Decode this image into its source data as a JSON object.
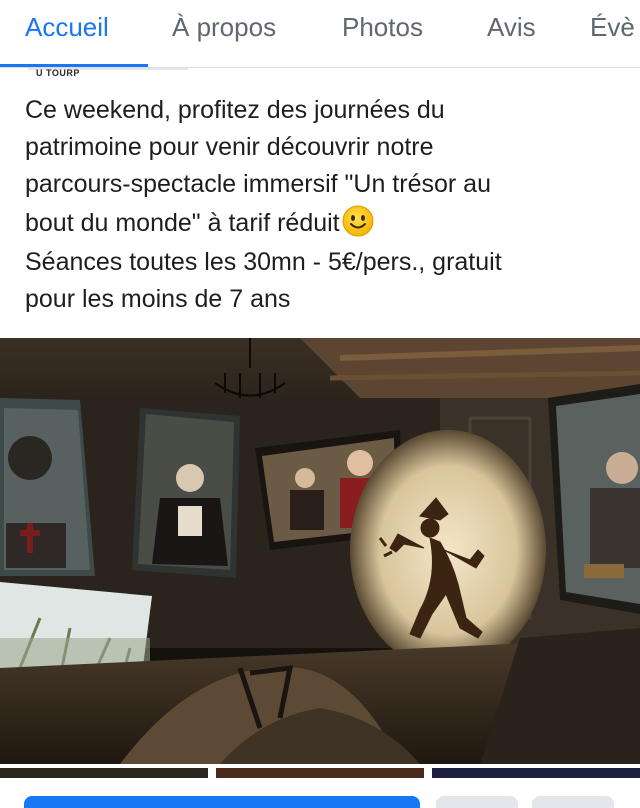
{
  "tabs": [
    {
      "label": "Accueil",
      "active": true
    },
    {
      "label": "À propos",
      "active": false
    },
    {
      "label": "Photos",
      "active": false
    },
    {
      "label": "Avis",
      "active": false
    },
    {
      "label": "Évè",
      "active": false
    }
  ],
  "post": {
    "brand_fragment": "U TOURP",
    "lines": [
      "Ce weekend, profitez des journées du",
      "patrimoine pour venir découvrir notre",
      "parcours-spectacle immersif \"Un trésor au",
      "bout du monde\" à tarif réduit",
      "Séances toutes les 30mn - 5€/pers., gratuit",
      "pour les moins de 7 ans"
    ],
    "emoji": "slightly-smiling-face"
  },
  "colors": {
    "accent": "#1877f2",
    "text": "#1c1e21",
    "muted": "#606770",
    "divider": "#dadde1",
    "button_secondary": "#e4e6eb"
  }
}
